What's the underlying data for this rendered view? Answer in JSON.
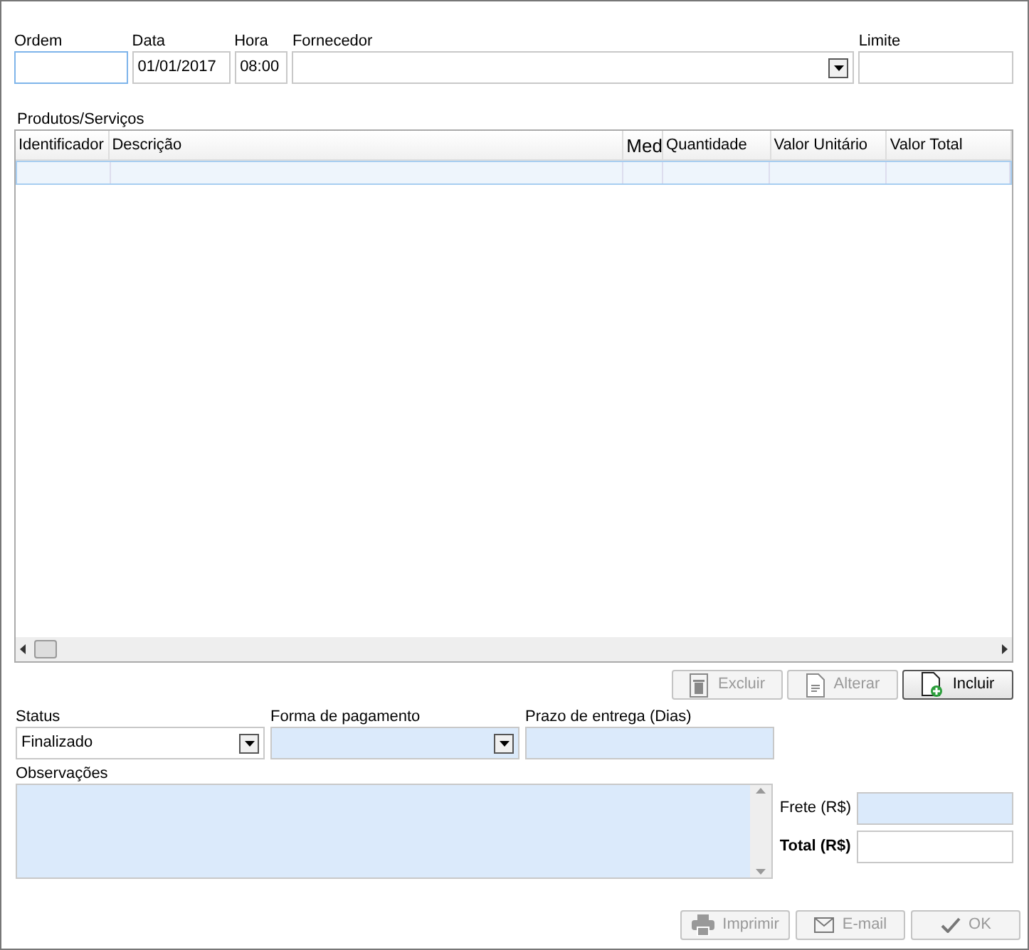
{
  "header_fields": [
    {
      "label": "Ordem",
      "kind": "text",
      "focused": true
    },
    {
      "label": "Data",
      "kind": "text",
      "value": "01/01/2017",
      "focused": false
    },
    {
      "label": "Hora",
      "kind": "text",
      "value": "08:00",
      "focused": false
    },
    {
      "label": "Fornecedor",
      "kind": "select",
      "focused": false
    },
    {
      "label": "Limite",
      "kind": "text",
      "focused": false
    }
  ],
  "products": {
    "label": "Produtos/Serviços",
    "columns": [
      "Identificador",
      "Descrição",
      "Med",
      "Quantidade",
      "Valor Unitário",
      "Valor Total"
    ],
    "rows": [
      {
        "selected": true
      }
    ]
  },
  "row_buttons": [
    {
      "label": "Excluir",
      "disabled": true
    },
    {
      "label": "Alterar",
      "disabled": true
    },
    {
      "label": "Incluir",
      "disabled": false
    }
  ],
  "detail_fields": [
    {
      "label": "Status",
      "kind": "select",
      "value": "Finalizado",
      "highlighted": false
    },
    {
      "label": "Forma de pagamento",
      "kind": "select",
      "highlighted": true
    },
    {
      "label": "Prazo de entrega (Dias)",
      "kind": "text",
      "highlighted": true
    }
  ],
  "notes": {
    "label": "Observações",
    "highlighted": true
  },
  "totals": [
    {
      "label": "Frete (R$)",
      "bold": false,
      "highlighted": true
    },
    {
      "label": "Total (R$)",
      "bold": true,
      "highlighted": false
    }
  ],
  "footer_buttons": [
    {
      "label": "Imprimir",
      "disabled": true
    },
    {
      "label": "E-mail",
      "disabled": true
    },
    {
      "label": "OK",
      "disabled": true
    }
  ]
}
